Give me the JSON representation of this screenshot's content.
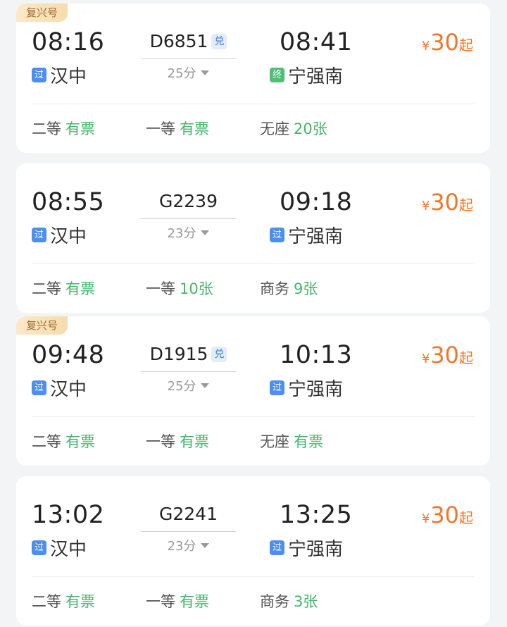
{
  "trains": [
    {
      "badge": "复兴号",
      "dep_time": "08:16",
      "train_no": "D6851",
      "exchange_icon": "兑",
      "arr_time": "08:41",
      "dep_tag": "过",
      "dep_station": "汉中",
      "duration": "25分",
      "arr_tag": "终",
      "arr_station": "宁强南",
      "price_currency": "¥",
      "price_value": "30",
      "price_suffix": "起",
      "seats": [
        {
          "class": "二等",
          "availability": "有票"
        },
        {
          "class": "一等",
          "availability": "有票"
        },
        {
          "class": "无座",
          "availability": "20张"
        }
      ]
    },
    {
      "badge": "",
      "dep_time": "08:55",
      "train_no": "G2239",
      "exchange_icon": "",
      "arr_time": "09:18",
      "dep_tag": "过",
      "dep_station": "汉中",
      "duration": "23分",
      "arr_tag": "过",
      "arr_station": "宁强南",
      "price_currency": "¥",
      "price_value": "30",
      "price_suffix": "起",
      "seats": [
        {
          "class": "二等",
          "availability": "有票"
        },
        {
          "class": "一等",
          "availability": "10张"
        },
        {
          "class": "商务",
          "availability": "9张"
        }
      ]
    },
    {
      "badge": "复兴号",
      "dep_time": "09:48",
      "train_no": "D1915",
      "exchange_icon": "兑",
      "arr_time": "10:13",
      "dep_tag": "过",
      "dep_station": "汉中",
      "duration": "25分",
      "arr_tag": "过",
      "arr_station": "宁强南",
      "price_currency": "¥",
      "price_value": "30",
      "price_suffix": "起",
      "seats": [
        {
          "class": "二等",
          "availability": "有票"
        },
        {
          "class": "一等",
          "availability": "有票"
        },
        {
          "class": "无座",
          "availability": "有票"
        }
      ]
    },
    {
      "badge": "",
      "dep_time": "13:02",
      "train_no": "G2241",
      "exchange_icon": "",
      "arr_time": "13:25",
      "dep_tag": "过",
      "dep_station": "汉中",
      "duration": "23分",
      "arr_tag": "过",
      "arr_station": "宁强南",
      "price_currency": "¥",
      "price_value": "30",
      "price_suffix": "起",
      "seats": [
        {
          "class": "二等",
          "availability": "有票"
        },
        {
          "class": "一等",
          "availability": "有票"
        },
        {
          "class": "商务",
          "availability": "3张"
        }
      ]
    }
  ],
  "colors": {
    "price": "#f0772c",
    "available": "#45b56c",
    "pass_tag": "#4d8ff0",
    "end_tag": "#4fbe79",
    "badge_text": "#a0672a"
  }
}
